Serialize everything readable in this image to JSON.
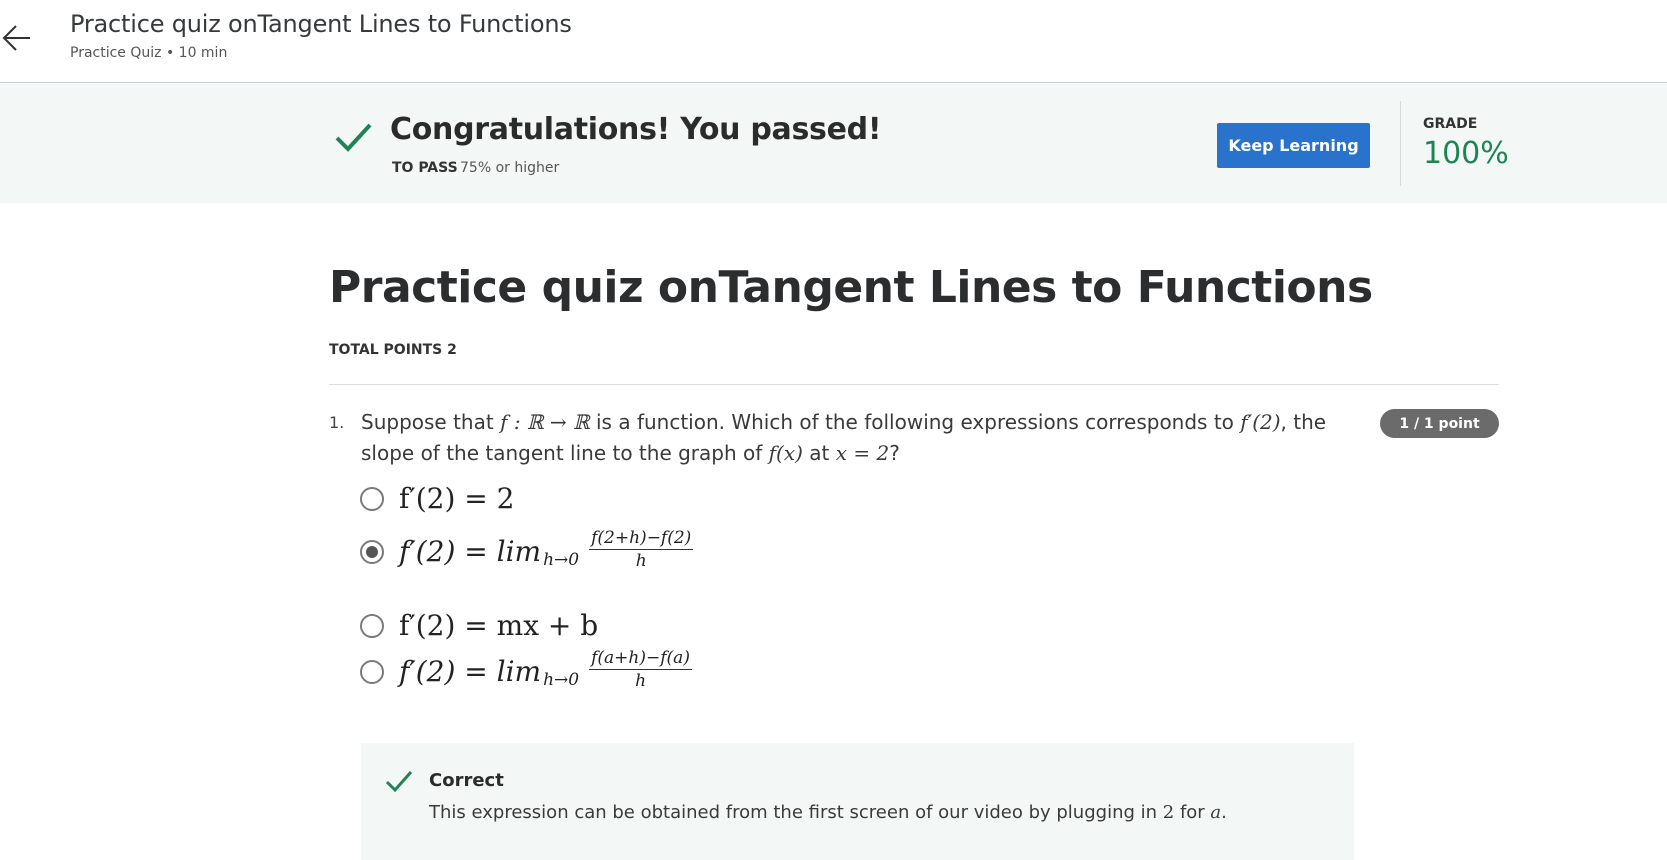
{
  "header": {
    "back_icon": "arrow-left-icon",
    "title": "Practice quiz onTangent Lines to Functions",
    "subtitle": "Practice Quiz • 10 min"
  },
  "banner": {
    "check_icon": "checkmark-icon",
    "title": "Congratulations! You passed!",
    "to_pass_label": "TO PASS",
    "to_pass_value": "75% or higher",
    "keep_learning_label": "Keep Learning",
    "grade_label": "GRADE",
    "grade_value": "100%",
    "colors": {
      "background": "#f3f8f6",
      "accent_green": "#1f8354",
      "button_blue": "#2a73cc"
    }
  },
  "quiz": {
    "title": "Practice quiz onTangent Lines to Functions",
    "total_points": "TOTAL POINTS 2",
    "questions": [
      {
        "number": "1.",
        "text_parts": [
          "Suppose that ",
          "f : ℝ → ℝ",
          " is a function. Which of the following expressions corresponds to ",
          "f′(2)",
          ", the slope of the tangent line to the graph of ",
          "f(x)",
          " at ",
          "x = 2",
          "?"
        ],
        "score_badge": "1 / 1 point",
        "options": [
          {
            "label": "f′(2) = 2",
            "selected": false
          },
          {
            "label_main": "f′(2) = lim",
            "label_sub": "h→0",
            "numerator": "f(2+h)−f(2)",
            "denominator": "h",
            "selected": true
          },
          {
            "label": "f′(2) = mx + b",
            "selected": false
          },
          {
            "label_main": "f′(2) = lim",
            "label_sub": "h→0",
            "numerator": "f(a+h)−f(a)",
            "denominator": "h",
            "selected": false
          }
        ],
        "feedback": {
          "icon": "checkmark-icon",
          "title": "Correct",
          "text_before": "This expression can be obtained from the first screen of our video by plugging in ",
          "math_value": "2",
          "text_middle": " for ",
          "math_var": "a",
          "text_after": "."
        }
      }
    ]
  }
}
